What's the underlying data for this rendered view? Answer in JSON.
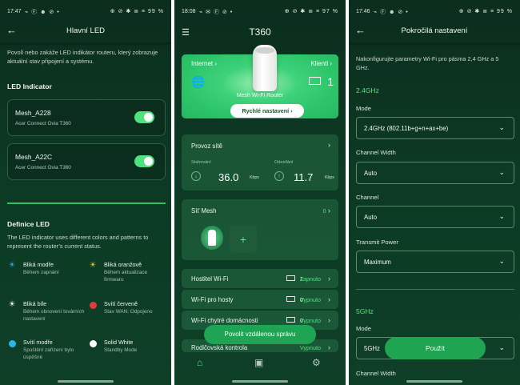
{
  "panel1": {
    "status": {
      "time": "17:47",
      "left_icons": "⌁ Ⓕ ☻ ⊘ •",
      "right_icons": "⊕ ⊘ ✱ ≣ ≡ 99 %"
    },
    "title": "Hlavní LED",
    "description": "Povolí nebo zakáže LED indikátor routeru, který zobrazuje aktuální stav připojení a systému.",
    "led_heading": "LED Indicator",
    "devices": [
      {
        "name": "Mesh_A228",
        "model": "Acer Connect Ovia T360",
        "enabled": true
      },
      {
        "name": "Mesh_A22C",
        "model": "Acer Connect Ovia T360",
        "enabled": true
      }
    ],
    "definition_heading": "Definice LED",
    "definition_text": "The LED indicator uses different colors and patterns to represent the router’s current status.",
    "legend": [
      {
        "title": "Bliká modře",
        "sub": "Během zapnání",
        "color": "#2aa8e6",
        "icon": "sun-blue"
      },
      {
        "title": "Bliká oranžově",
        "sub": "Během aktualizace firmwaru",
        "color": "#e8c12b",
        "icon": "sun-orange"
      },
      {
        "title": "Bliká bíle",
        "sub": "Během obnovení továrních nastavení",
        "color": "#ffffff",
        "icon": "sun-white"
      },
      {
        "title": "Svítí červeně",
        "sub": "Stav WAN: Odpojeno",
        "color": "#e23b3b",
        "icon": "dot-red"
      },
      {
        "title": "Svítí modře",
        "sub": "Spuštění zařízení bylo úspěšné",
        "color": "#27b7e6",
        "icon": "dot-cyan"
      },
      {
        "title": "Solid White",
        "sub": "Standby Mode",
        "color": "#ffffff",
        "icon": "dot-white"
      }
    ]
  },
  "panel2": {
    "status": {
      "time": "18:08",
      "left_icons": "⌁ ✉ Ⓕ ⊘ •",
      "right_icons": "⊕ ⊘ ✱ ≣ ≡ 97 %"
    },
    "title": "T360",
    "internet_label": "Internet",
    "clients_label": "Klienti",
    "clients_count": "1",
    "router_name": "Mesh Wi-Fi Router",
    "quick_setup": "Rychlé nastavení",
    "traffic_label": "Provoz sítě",
    "download_label": "Stahování",
    "upload_label": "Odesílání",
    "download_value": "36.0",
    "upload_value": "11.7",
    "speed_unit": "Kbps",
    "mesh_label": "Síť Mesh",
    "mesh_count": "0",
    "add_label": "+",
    "rows": [
      {
        "label": "Hostitel Wi-Fi",
        "count": "1",
        "status": "Zapnuto"
      },
      {
        "label": "Wi-Fi pro hosty",
        "count": "0",
        "status": "Vypnuto"
      },
      {
        "label": "Wi-Fi chytré domácnosti",
        "count": "0",
        "status": "Vypnuto"
      },
      {
        "label": "Rodičovská kontrola",
        "count": "",
        "status": "Vypnuto"
      }
    ],
    "toast": "Povolit vzdálenou správu"
  },
  "panel3": {
    "status": {
      "time": "17:46",
      "left_icons": "⌁ Ⓕ ☻ ⊘ •",
      "right_icons": "⊕ ⊘ ✱ ≣ ≡ 99 %"
    },
    "title": "Pokročilá nastavení",
    "description": "Nakonfigurujte parametry Wi-Fi pro pásma 2,4 GHz a 5 GHz.",
    "section_24": "2.4GHz",
    "fields": [
      {
        "label": "Mode",
        "value": "2.4GHz (802.11b+g+n+ax+be)"
      },
      {
        "label": "Channel Width",
        "value": "Auto"
      },
      {
        "label": "Channel",
        "value": "Auto"
      },
      {
        "label": "Transmit Power",
        "value": "Maximum"
      }
    ],
    "section_5": "5GHz",
    "mode5_label": "Mode",
    "mode5_value": "5GHz",
    "width5_label": "Channel Width",
    "apply": "Použít"
  }
}
